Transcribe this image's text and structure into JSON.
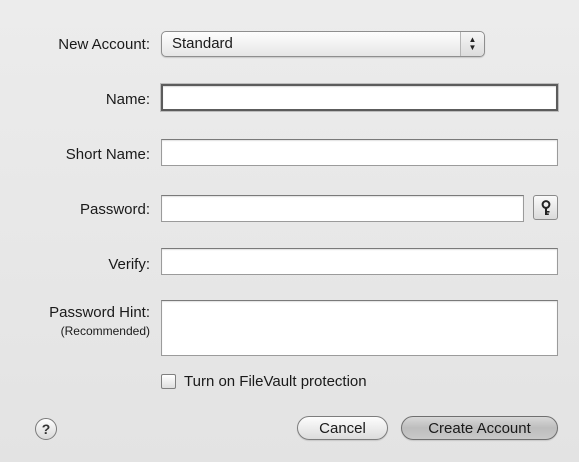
{
  "labels": {
    "new_account": "New Account:",
    "name": "Name:",
    "short_name": "Short Name:",
    "password": "Password:",
    "verify": "Verify:",
    "password_hint": "Password Hint:",
    "password_hint_sub": "(Recommended)"
  },
  "account_type": {
    "selected": "Standard"
  },
  "fields": {
    "name": "",
    "short_name": "",
    "password": "",
    "verify": "",
    "password_hint": ""
  },
  "filevault": {
    "label": "Turn on FileVault protection",
    "checked": false
  },
  "buttons": {
    "help": "?",
    "cancel": "Cancel",
    "create": "Create Account"
  },
  "icons": {
    "password_assistant": "key-icon",
    "popup_arrows": "up-down-arrows-icon"
  }
}
